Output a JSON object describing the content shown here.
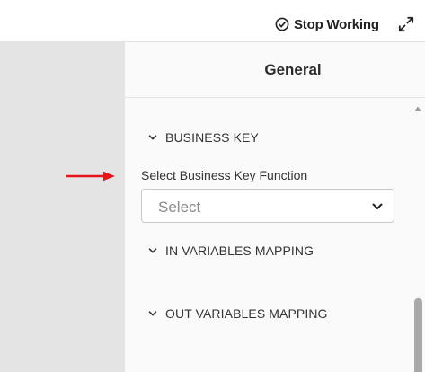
{
  "toolbar": {
    "stop_working_label": "Stop Working"
  },
  "panel": {
    "title": "General",
    "sections": {
      "business_key": "BUSINESS KEY",
      "in_variables": "IN VARIABLES MAPPING",
      "out_variables": "OUT VARIABLES MAPPING"
    },
    "business_key_field": {
      "label": "Select Business Key Function",
      "value": "Select"
    }
  },
  "colors": {
    "annotation_arrow": "#e8141c",
    "left_pane": "#e4e4e4",
    "panel_bg": "#fafafa"
  },
  "icons": {
    "stop_working": "check-circle-icon",
    "expand": "expand-icon",
    "section_toggle": "chevron-down-icon",
    "select_toggle": "chevron-down-icon"
  }
}
